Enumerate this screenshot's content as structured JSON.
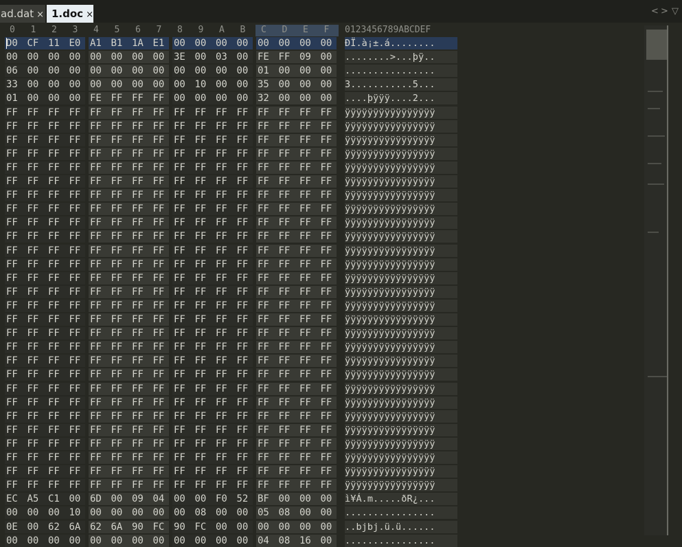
{
  "tabs": [
    {
      "label": "ad.dat",
      "active": false
    },
    {
      "label": "1.doc",
      "active": true
    }
  ],
  "close_glyph": "×",
  "nav": {
    "left": "<",
    "right": ">",
    "menu": "▽"
  },
  "header": {
    "columns": [
      "0",
      "1",
      "2",
      "3",
      "4",
      "5",
      "6",
      "7",
      "8",
      "9",
      "A",
      "B",
      "C",
      "D",
      "E",
      "F"
    ],
    "ascii_label": "0123456789ABCDEF"
  },
  "colors": {
    "background": "#272822",
    "selection": "#293b57",
    "text": "#d4d4cc"
  },
  "hex_rows": [
    {
      "bytes": [
        "D0",
        "CF",
        "11",
        "E0",
        "A1",
        "B1",
        "1A",
        "E1",
        "00",
        "00",
        "00",
        "00",
        "00",
        "00",
        "00",
        "00"
      ],
      "ascii": "ÐÏ.à¡±.á........"
    },
    {
      "bytes": [
        "00",
        "00",
        "00",
        "00",
        "00",
        "00",
        "00",
        "00",
        "3E",
        "00",
        "03",
        "00",
        "FE",
        "FF",
        "09",
        "00"
      ],
      "ascii": "........>...þÿ.."
    },
    {
      "bytes": [
        "06",
        "00",
        "00",
        "00",
        "00",
        "00",
        "00",
        "00",
        "00",
        "00",
        "00",
        "00",
        "01",
        "00",
        "00",
        "00"
      ],
      "ascii": "................"
    },
    {
      "bytes": [
        "33",
        "00",
        "00",
        "00",
        "00",
        "00",
        "00",
        "00",
        "00",
        "10",
        "00",
        "00",
        "35",
        "00",
        "00",
        "00"
      ],
      "ascii": "3...........5..."
    },
    {
      "bytes": [
        "01",
        "00",
        "00",
        "00",
        "FE",
        "FF",
        "FF",
        "FF",
        "00",
        "00",
        "00",
        "00",
        "32",
        "00",
        "00",
        "00"
      ],
      "ascii": "....þÿÿÿ....2..."
    },
    {
      "bytes": [
        "FF",
        "FF",
        "FF",
        "FF",
        "FF",
        "FF",
        "FF",
        "FF",
        "FF",
        "FF",
        "FF",
        "FF",
        "FF",
        "FF",
        "FF",
        "FF"
      ],
      "ascii": "ÿÿÿÿÿÿÿÿÿÿÿÿÿÿÿÿ"
    },
    {
      "bytes": [
        "FF",
        "FF",
        "FF",
        "FF",
        "FF",
        "FF",
        "FF",
        "FF",
        "FF",
        "FF",
        "FF",
        "FF",
        "FF",
        "FF",
        "FF",
        "FF"
      ],
      "ascii": "ÿÿÿÿÿÿÿÿÿÿÿÿÿÿÿÿ"
    },
    {
      "bytes": [
        "FF",
        "FF",
        "FF",
        "FF",
        "FF",
        "FF",
        "FF",
        "FF",
        "FF",
        "FF",
        "FF",
        "FF",
        "FF",
        "FF",
        "FF",
        "FF"
      ],
      "ascii": "ÿÿÿÿÿÿÿÿÿÿÿÿÿÿÿÿ"
    },
    {
      "bytes": [
        "FF",
        "FF",
        "FF",
        "FF",
        "FF",
        "FF",
        "FF",
        "FF",
        "FF",
        "FF",
        "FF",
        "FF",
        "FF",
        "FF",
        "FF",
        "FF"
      ],
      "ascii": "ÿÿÿÿÿÿÿÿÿÿÿÿÿÿÿÿ"
    },
    {
      "bytes": [
        "FF",
        "FF",
        "FF",
        "FF",
        "FF",
        "FF",
        "FF",
        "FF",
        "FF",
        "FF",
        "FF",
        "FF",
        "FF",
        "FF",
        "FF",
        "FF"
      ],
      "ascii": "ÿÿÿÿÿÿÿÿÿÿÿÿÿÿÿÿ"
    },
    {
      "bytes": [
        "FF",
        "FF",
        "FF",
        "FF",
        "FF",
        "FF",
        "FF",
        "FF",
        "FF",
        "FF",
        "FF",
        "FF",
        "FF",
        "FF",
        "FF",
        "FF"
      ],
      "ascii": "ÿÿÿÿÿÿÿÿÿÿÿÿÿÿÿÿ"
    },
    {
      "bytes": [
        "FF",
        "FF",
        "FF",
        "FF",
        "FF",
        "FF",
        "FF",
        "FF",
        "FF",
        "FF",
        "FF",
        "FF",
        "FF",
        "FF",
        "FF",
        "FF"
      ],
      "ascii": "ÿÿÿÿÿÿÿÿÿÿÿÿÿÿÿÿ"
    },
    {
      "bytes": [
        "FF",
        "FF",
        "FF",
        "FF",
        "FF",
        "FF",
        "FF",
        "FF",
        "FF",
        "FF",
        "FF",
        "FF",
        "FF",
        "FF",
        "FF",
        "FF"
      ],
      "ascii": "ÿÿÿÿÿÿÿÿÿÿÿÿÿÿÿÿ"
    },
    {
      "bytes": [
        "FF",
        "FF",
        "FF",
        "FF",
        "FF",
        "FF",
        "FF",
        "FF",
        "FF",
        "FF",
        "FF",
        "FF",
        "FF",
        "FF",
        "FF",
        "FF"
      ],
      "ascii": "ÿÿÿÿÿÿÿÿÿÿÿÿÿÿÿÿ"
    },
    {
      "bytes": [
        "FF",
        "FF",
        "FF",
        "FF",
        "FF",
        "FF",
        "FF",
        "FF",
        "FF",
        "FF",
        "FF",
        "FF",
        "FF",
        "FF",
        "FF",
        "FF"
      ],
      "ascii": "ÿÿÿÿÿÿÿÿÿÿÿÿÿÿÿÿ"
    },
    {
      "bytes": [
        "FF",
        "FF",
        "FF",
        "FF",
        "FF",
        "FF",
        "FF",
        "FF",
        "FF",
        "FF",
        "FF",
        "FF",
        "FF",
        "FF",
        "FF",
        "FF"
      ],
      "ascii": "ÿÿÿÿÿÿÿÿÿÿÿÿÿÿÿÿ"
    },
    {
      "bytes": [
        "FF",
        "FF",
        "FF",
        "FF",
        "FF",
        "FF",
        "FF",
        "FF",
        "FF",
        "FF",
        "FF",
        "FF",
        "FF",
        "FF",
        "FF",
        "FF"
      ],
      "ascii": "ÿÿÿÿÿÿÿÿÿÿÿÿÿÿÿÿ"
    },
    {
      "bytes": [
        "FF",
        "FF",
        "FF",
        "FF",
        "FF",
        "FF",
        "FF",
        "FF",
        "FF",
        "FF",
        "FF",
        "FF",
        "FF",
        "FF",
        "FF",
        "FF"
      ],
      "ascii": "ÿÿÿÿÿÿÿÿÿÿÿÿÿÿÿÿ"
    },
    {
      "bytes": [
        "FF",
        "FF",
        "FF",
        "FF",
        "FF",
        "FF",
        "FF",
        "FF",
        "FF",
        "FF",
        "FF",
        "FF",
        "FF",
        "FF",
        "FF",
        "FF"
      ],
      "ascii": "ÿÿÿÿÿÿÿÿÿÿÿÿÿÿÿÿ"
    },
    {
      "bytes": [
        "FF",
        "FF",
        "FF",
        "FF",
        "FF",
        "FF",
        "FF",
        "FF",
        "FF",
        "FF",
        "FF",
        "FF",
        "FF",
        "FF",
        "FF",
        "FF"
      ],
      "ascii": "ÿÿÿÿÿÿÿÿÿÿÿÿÿÿÿÿ"
    },
    {
      "bytes": [
        "FF",
        "FF",
        "FF",
        "FF",
        "FF",
        "FF",
        "FF",
        "FF",
        "FF",
        "FF",
        "FF",
        "FF",
        "FF",
        "FF",
        "FF",
        "FF"
      ],
      "ascii": "ÿÿÿÿÿÿÿÿÿÿÿÿÿÿÿÿ"
    },
    {
      "bytes": [
        "FF",
        "FF",
        "FF",
        "FF",
        "FF",
        "FF",
        "FF",
        "FF",
        "FF",
        "FF",
        "FF",
        "FF",
        "FF",
        "FF",
        "FF",
        "FF"
      ],
      "ascii": "ÿÿÿÿÿÿÿÿÿÿÿÿÿÿÿÿ"
    },
    {
      "bytes": [
        "FF",
        "FF",
        "FF",
        "FF",
        "FF",
        "FF",
        "FF",
        "FF",
        "FF",
        "FF",
        "FF",
        "FF",
        "FF",
        "FF",
        "FF",
        "FF"
      ],
      "ascii": "ÿÿÿÿÿÿÿÿÿÿÿÿÿÿÿÿ"
    },
    {
      "bytes": [
        "FF",
        "FF",
        "FF",
        "FF",
        "FF",
        "FF",
        "FF",
        "FF",
        "FF",
        "FF",
        "FF",
        "FF",
        "FF",
        "FF",
        "FF",
        "FF"
      ],
      "ascii": "ÿÿÿÿÿÿÿÿÿÿÿÿÿÿÿÿ"
    },
    {
      "bytes": [
        "FF",
        "FF",
        "FF",
        "FF",
        "FF",
        "FF",
        "FF",
        "FF",
        "FF",
        "FF",
        "FF",
        "FF",
        "FF",
        "FF",
        "FF",
        "FF"
      ],
      "ascii": "ÿÿÿÿÿÿÿÿÿÿÿÿÿÿÿÿ"
    },
    {
      "bytes": [
        "FF",
        "FF",
        "FF",
        "FF",
        "FF",
        "FF",
        "FF",
        "FF",
        "FF",
        "FF",
        "FF",
        "FF",
        "FF",
        "FF",
        "FF",
        "FF"
      ],
      "ascii": "ÿÿÿÿÿÿÿÿÿÿÿÿÿÿÿÿ"
    },
    {
      "bytes": [
        "FF",
        "FF",
        "FF",
        "FF",
        "FF",
        "FF",
        "FF",
        "FF",
        "FF",
        "FF",
        "FF",
        "FF",
        "FF",
        "FF",
        "FF",
        "FF"
      ],
      "ascii": "ÿÿÿÿÿÿÿÿÿÿÿÿÿÿÿÿ"
    },
    {
      "bytes": [
        "FF",
        "FF",
        "FF",
        "FF",
        "FF",
        "FF",
        "FF",
        "FF",
        "FF",
        "FF",
        "FF",
        "FF",
        "FF",
        "FF",
        "FF",
        "FF"
      ],
      "ascii": "ÿÿÿÿÿÿÿÿÿÿÿÿÿÿÿÿ"
    },
    {
      "bytes": [
        "FF",
        "FF",
        "FF",
        "FF",
        "FF",
        "FF",
        "FF",
        "FF",
        "FF",
        "FF",
        "FF",
        "FF",
        "FF",
        "FF",
        "FF",
        "FF"
      ],
      "ascii": "ÿÿÿÿÿÿÿÿÿÿÿÿÿÿÿÿ"
    },
    {
      "bytes": [
        "FF",
        "FF",
        "FF",
        "FF",
        "FF",
        "FF",
        "FF",
        "FF",
        "FF",
        "FF",
        "FF",
        "FF",
        "FF",
        "FF",
        "FF",
        "FF"
      ],
      "ascii": "ÿÿÿÿÿÿÿÿÿÿÿÿÿÿÿÿ"
    },
    {
      "bytes": [
        "FF",
        "FF",
        "FF",
        "FF",
        "FF",
        "FF",
        "FF",
        "FF",
        "FF",
        "FF",
        "FF",
        "FF",
        "FF",
        "FF",
        "FF",
        "FF"
      ],
      "ascii": "ÿÿÿÿÿÿÿÿÿÿÿÿÿÿÿÿ"
    },
    {
      "bytes": [
        "FF",
        "FF",
        "FF",
        "FF",
        "FF",
        "FF",
        "FF",
        "FF",
        "FF",
        "FF",
        "FF",
        "FF",
        "FF",
        "FF",
        "FF",
        "FF"
      ],
      "ascii": "ÿÿÿÿÿÿÿÿÿÿÿÿÿÿÿÿ"
    },
    {
      "bytes": [
        "FF",
        "FF",
        "FF",
        "FF",
        "FF",
        "FF",
        "FF",
        "FF",
        "FF",
        "FF",
        "FF",
        "FF",
        "FF",
        "FF",
        "FF",
        "FF"
      ],
      "ascii": "ÿÿÿÿÿÿÿÿÿÿÿÿÿÿÿÿ"
    },
    {
      "bytes": [
        "EC",
        "A5",
        "C1",
        "00",
        "6D",
        "00",
        "09",
        "04",
        "00",
        "00",
        "F0",
        "52",
        "BF",
        "00",
        "00",
        "00"
      ],
      "ascii": "ì¥Á.m.....ðR¿..."
    },
    {
      "bytes": [
        "00",
        "00",
        "00",
        "10",
        "00",
        "00",
        "00",
        "00",
        "00",
        "08",
        "00",
        "00",
        "05",
        "08",
        "00",
        "00"
      ],
      "ascii": "................"
    },
    {
      "bytes": [
        "0E",
        "00",
        "62",
        "6A",
        "62",
        "6A",
        "90",
        "FC",
        "90",
        "FC",
        "00",
        "00",
        "00",
        "00",
        "00",
        "00"
      ],
      "ascii": "..bjbj.ü.ü......"
    },
    {
      "bytes": [
        "00",
        "00",
        "00",
        "00",
        "00",
        "00",
        "00",
        "00",
        "00",
        "00",
        "00",
        "00",
        "04",
        "08",
        "16",
        "00"
      ],
      "ascii": "................"
    }
  ]
}
